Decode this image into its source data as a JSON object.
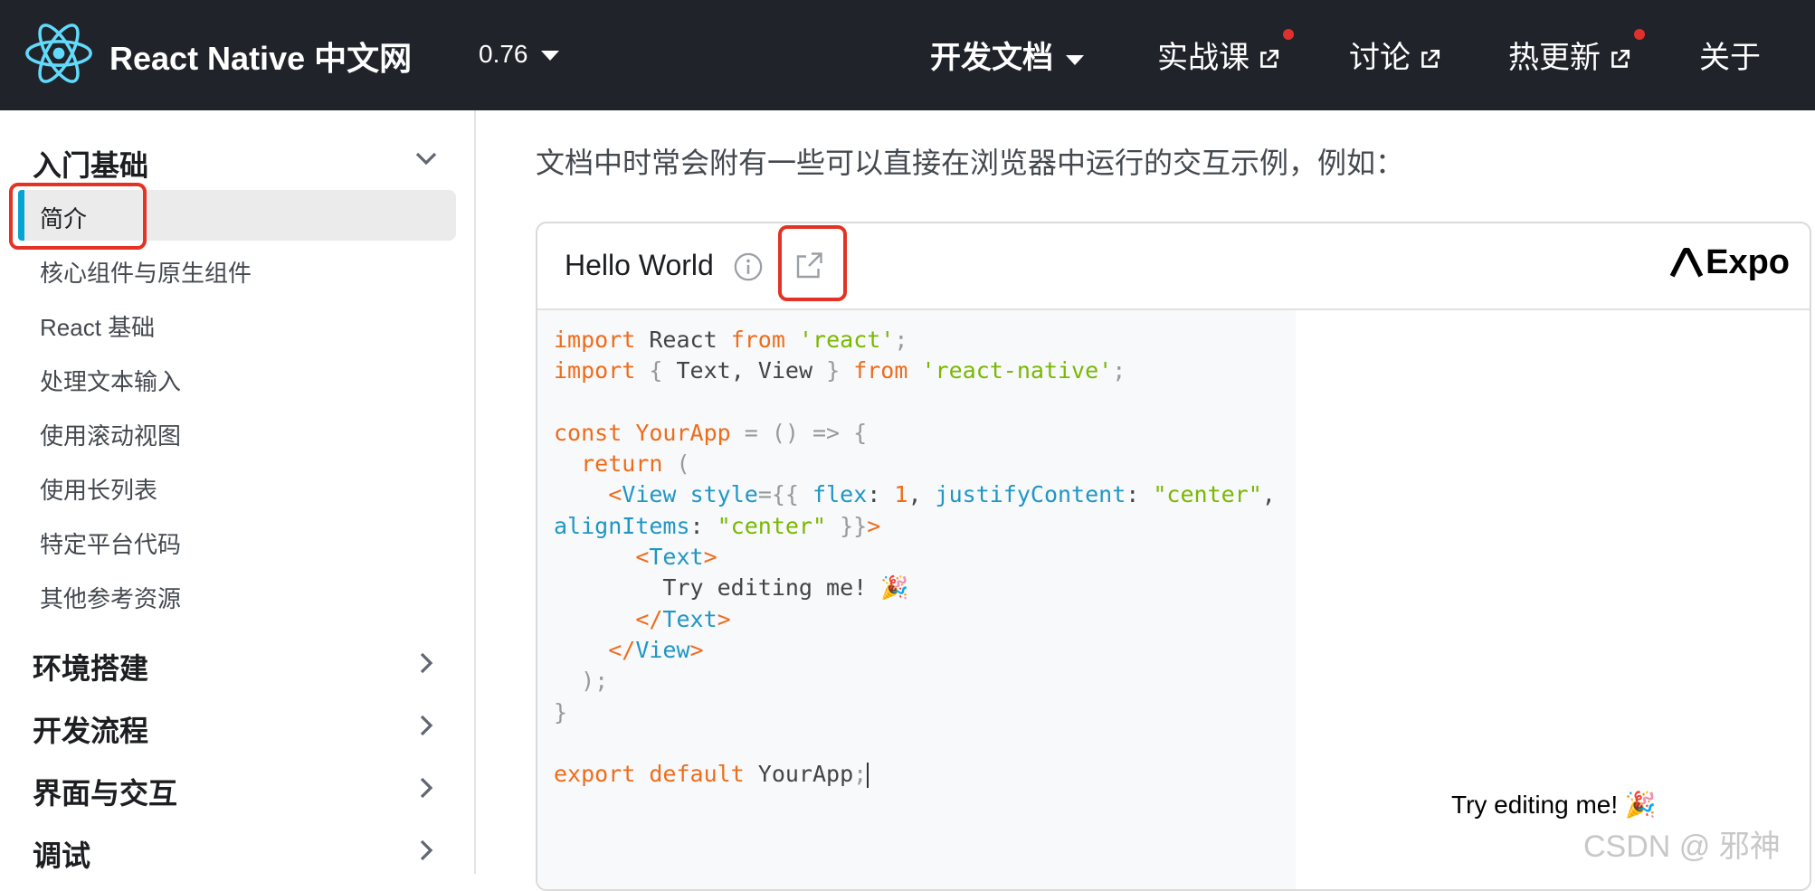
{
  "navbar": {
    "brand": "React Native 中文网",
    "version": "0.76",
    "items": [
      {
        "label": "开发文档"
      },
      {
        "label": "实战课"
      },
      {
        "label": "讨论"
      },
      {
        "label": "热更新"
      },
      {
        "label": "关于"
      }
    ]
  },
  "sidebar": {
    "section_intro": {
      "label": "入门基础",
      "items": [
        {
          "label": "简介",
          "active": true
        },
        {
          "label": "核心组件与原生组件"
        },
        {
          "label": "React 基础"
        },
        {
          "label": "处理文本输入"
        },
        {
          "label": "使用滚动视图"
        },
        {
          "label": "使用长列表"
        },
        {
          "label": "特定平台代码"
        },
        {
          "label": "其他参考资源"
        }
      ]
    },
    "sections": [
      {
        "label": "环境搭建"
      },
      {
        "label": "开发流程"
      },
      {
        "label": "界面与交互"
      },
      {
        "label": "调试"
      }
    ]
  },
  "main": {
    "intro_text": "文档中时常会附有一些可以直接在浏览器中运行的交互示例，例如："
  },
  "snack": {
    "title": "Hello World",
    "brand": "Expo",
    "preview_text": "Try editing me! 🎉"
  },
  "code": {
    "import1_kw": "import",
    "import1_name": "React",
    "import1_from": "from",
    "import1_mod": "'react'",
    "import2_kw": "import",
    "import2_names": "Text, View",
    "import2_from": "from",
    "import2_mod": "'react-native'",
    "const_kw": "const",
    "fn_name": "YourApp",
    "return_kw": "return",
    "view_tag": "View",
    "style_attr": "style",
    "flex_key": "flex",
    "flex_val": "1",
    "jc_key": "justifyContent",
    "jc_val": "\"center\"",
    "ai_key": "alignItems",
    "ai_val": "\"center\"",
    "text_tag": "Text",
    "text_content": "Try editing me! 🎉",
    "export_kw": "export default",
    "export_name": "YourApp"
  },
  "colors": {
    "navbar_bg": "#20232a",
    "react_blue": "#61dafb",
    "active_bar": "#05a5d1",
    "highlight_red": "#e33325",
    "keyword": "#ef6c1b",
    "string": "#7ab800",
    "tag": "#2196c4"
  },
  "watermark": "CSDN @ 邪神"
}
